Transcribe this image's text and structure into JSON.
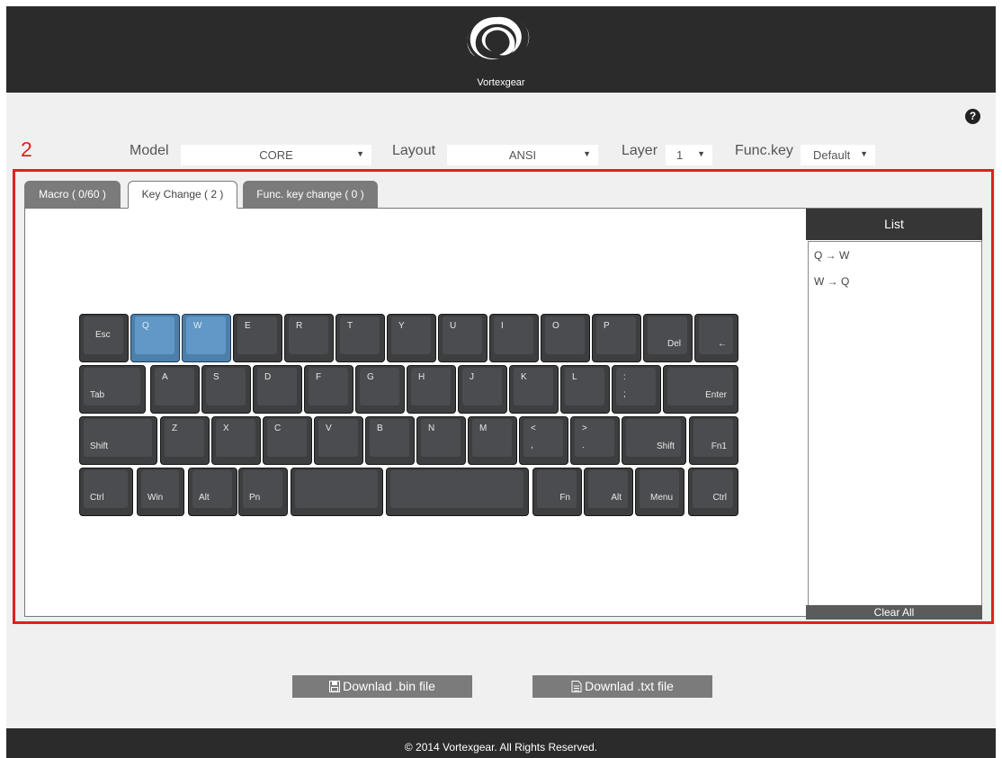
{
  "header": {
    "brand": "Vortexgear"
  },
  "help_icon": "question-circle-icon",
  "step_number": "2",
  "toolbar": {
    "model_label": "Model",
    "model_value": "CORE",
    "layout_label": "Layout",
    "layout_value": "ANSI",
    "layer_label": "Layer",
    "layer_value": "1",
    "funckey_label": "Func.key",
    "funckey_value": "Default"
  },
  "tabs": [
    {
      "label": "Macro ( 0/60 )",
      "active": false
    },
    {
      "label": "Key Change ( 2 )",
      "active": true
    },
    {
      "label": "Func. key change ( 0 )",
      "active": false
    }
  ],
  "keyboard": {
    "selected_keys": [
      "Q",
      "W"
    ],
    "selected_color": "#6098c8",
    "rows": [
      [
        {
          "id": "esc",
          "legend": "Esc"
        },
        {
          "id": "q",
          "legend": "Q"
        },
        {
          "id": "w",
          "legend": "W"
        },
        {
          "id": "e",
          "legend": "E"
        },
        {
          "id": "r",
          "legend": "R"
        },
        {
          "id": "t",
          "legend": "T"
        },
        {
          "id": "y",
          "legend": "Y"
        },
        {
          "id": "u",
          "legend": "U"
        },
        {
          "id": "i",
          "legend": "I"
        },
        {
          "id": "o",
          "legend": "O"
        },
        {
          "id": "p",
          "legend": "P"
        },
        {
          "id": "del",
          "legend": "Del"
        },
        {
          "id": "backspace",
          "legend": "←"
        }
      ],
      [
        {
          "id": "tab",
          "legend": "Tab"
        },
        {
          "id": "a",
          "legend": "A"
        },
        {
          "id": "s",
          "legend": "S"
        },
        {
          "id": "d",
          "legend": "D"
        },
        {
          "id": "f",
          "legend": "F"
        },
        {
          "id": "g",
          "legend": "G"
        },
        {
          "id": "h",
          "legend": "H"
        },
        {
          "id": "j",
          "legend": "J"
        },
        {
          "id": "k",
          "legend": "K"
        },
        {
          "id": "l",
          "legend": "L"
        },
        {
          "id": "semicolon",
          "legend": ":",
          "sub": ";"
        },
        {
          "id": "enter",
          "legend": "Enter"
        }
      ],
      [
        {
          "id": "lshift",
          "legend": "Shift"
        },
        {
          "id": "z",
          "legend": "Z"
        },
        {
          "id": "x",
          "legend": "X"
        },
        {
          "id": "c",
          "legend": "C"
        },
        {
          "id": "v",
          "legend": "V"
        },
        {
          "id": "b",
          "legend": "B"
        },
        {
          "id": "n",
          "legend": "N"
        },
        {
          "id": "m",
          "legend": "M"
        },
        {
          "id": "comma",
          "legend": "<",
          "sub": ","
        },
        {
          "id": "period",
          "legend": ">",
          "sub": "."
        },
        {
          "id": "rshift",
          "legend": "Shift"
        },
        {
          "id": "fn1",
          "legend": "Fn1"
        }
      ],
      [
        {
          "id": "lctrl",
          "legend": "Ctrl"
        },
        {
          "id": "win",
          "legend": "Win"
        },
        {
          "id": "lalt",
          "legend": "Alt"
        },
        {
          "id": "pn",
          "legend": "Pn"
        },
        {
          "id": "space1",
          "legend": ""
        },
        {
          "id": "space2",
          "legend": ""
        },
        {
          "id": "fn",
          "legend": "Fn"
        },
        {
          "id": "ralt",
          "legend": "Alt"
        },
        {
          "id": "menu",
          "legend": "Menu"
        },
        {
          "id": "rctrl",
          "legend": "Ctrl"
        }
      ]
    ]
  },
  "list": {
    "title": "List",
    "items": [
      "Q → W",
      "W → Q"
    ],
    "clear_label": "Clear All"
  },
  "downloads": {
    "bin_label": "Downlad .bin file",
    "txt_label": "Downlad .txt file"
  },
  "footer": {
    "copyright": "© 2014 Vortexgear. All Rights Reserved."
  }
}
